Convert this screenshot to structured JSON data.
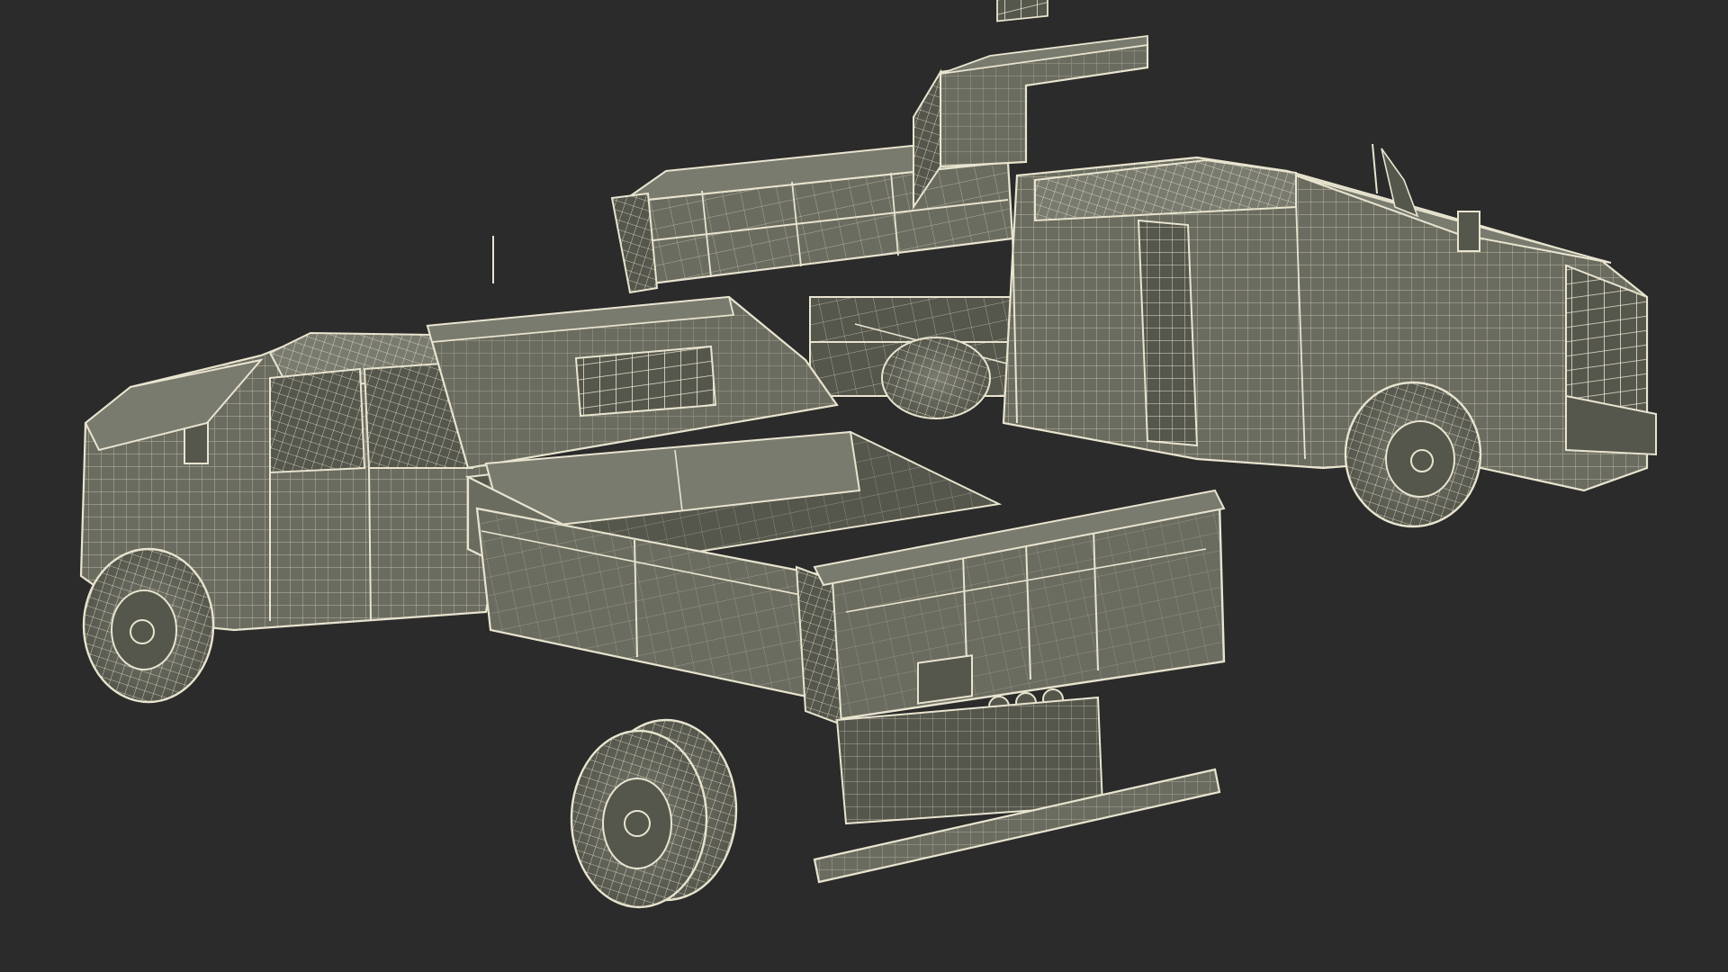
{
  "scene": {
    "background": "#2b2b2b",
    "model_fill": "#6b6c60",
    "model_fill_dark": "#55564c",
    "model_fill_light": "#7a7b6f",
    "wire_color": "#e8e4cf",
    "wire_color_dim": "#c9c5ae",
    "subjects": [
      {
        "name": "dump-truck-front-view",
        "bed_state": "closed"
      },
      {
        "name": "dump-truck-rear-view",
        "bed_state": "raised"
      }
    ]
  }
}
